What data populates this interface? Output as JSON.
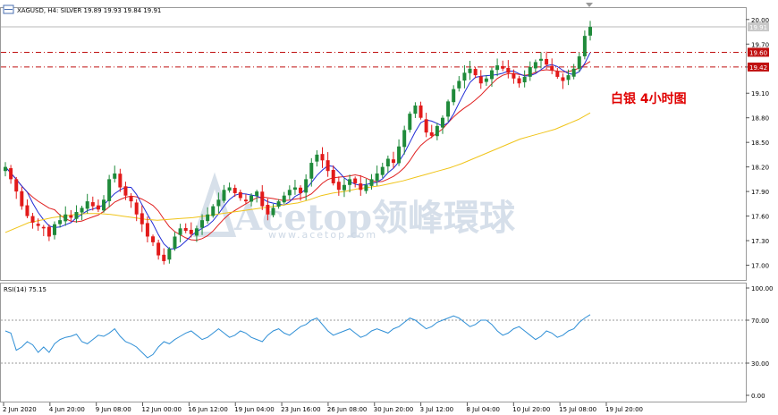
{
  "header": {
    "symbol_line": "XAGUSD, H4:  SILVER  19.89 19.93 19.84 19.91"
  },
  "annotation": "白银 4小时图",
  "watermark": {
    "brand": "Acetop领峰環球",
    "url": "www.acetop.com"
  },
  "price_axis": {
    "ticks": [
      "20.00",
      "19.70",
      "19.42",
      "19.10",
      "18.80",
      "18.50",
      "18.20",
      "17.90",
      "17.60",
      "17.30",
      "17.00"
    ],
    "tick_values": [
      20.0,
      19.7,
      19.42,
      19.1,
      18.8,
      18.5,
      18.2,
      17.9,
      17.6,
      17.3,
      17.0
    ],
    "ylim": [
      16.82,
      20.14
    ]
  },
  "rsi_axis": {
    "label": "RSI(14) 75.15",
    "ticks": [
      "100.00",
      "70.00",
      "30.00",
      "0.00"
    ],
    "tick_values": [
      100,
      70,
      30,
      0
    ],
    "levels": [
      70,
      30
    ]
  },
  "current_price": "19.91",
  "levels": [
    {
      "value": 19.6,
      "label": "19.60"
    },
    {
      "value": 19.42,
      "label": "19.42"
    }
  ],
  "colors": {
    "bull": "#1f8a3a",
    "bear": "#e21a1a",
    "ma_fast": "#1f2bd6",
    "ma_mid": "#e02020",
    "ma_slow": "#f0c419",
    "rsi": "#2f8fd6",
    "level_line": "#c01010",
    "grid": "#d8d8d8"
  },
  "time_axis": [
    "2 Jun 2020",
    "4 Jun 20:00",
    "9 Jun 08:00",
    "12 Jun 00:00",
    "16 Jun 12:00",
    "19 Jun 04:00",
    "23 Jun 16:00",
    "26 Jun 08:00",
    "30 Jun 20:00",
    "3 Jul 12:00",
    "8 Jul 04:00",
    "10 Jul 20:00",
    "15 Jul 08:00",
    "19 Jul 20:00"
  ],
  "chart_data": {
    "type": "candlestick",
    "title": "XAGUSD, H4: SILVER",
    "ylim": [
      16.82,
      20.14
    ],
    "x_labels": [
      "2 Jun 2020",
      "4 Jun 20:00",
      "9 Jun 08:00",
      "12 Jun 00:00",
      "16 Jun 12:00",
      "19 Jun 04:00",
      "23 Jun 16:00",
      "26 Jun 08:00",
      "30 Jun 20:00",
      "3 Jul 12:00",
      "8 Jul 04:00",
      "10 Jul 20:00",
      "15 Jul 08:00",
      "19 Jul 20:00"
    ],
    "close_path": [
      18.2,
      18.05,
      17.9,
      17.72,
      17.6,
      17.52,
      17.48,
      17.45,
      17.35,
      17.5,
      17.55,
      17.62,
      17.58,
      17.65,
      17.7,
      17.78,
      17.72,
      17.68,
      17.8,
      18.05,
      18.12,
      17.95,
      17.85,
      17.78,
      17.62,
      17.5,
      17.35,
      17.28,
      17.12,
      17.05,
      17.2,
      17.35,
      17.45,
      17.42,
      17.38,
      17.45,
      17.55,
      17.62,
      17.72,
      17.8,
      17.92,
      17.95,
      17.88,
      17.82,
      17.78,
      17.85,
      17.9,
      17.72,
      17.62,
      17.7,
      17.78,
      17.85,
      17.92,
      17.95,
      17.88,
      18.05,
      18.25,
      18.35,
      18.28,
      18.15,
      18.0,
      17.92,
      17.98,
      18.05,
      18.0,
      17.92,
      17.98,
      18.05,
      18.12,
      18.2,
      18.3,
      18.25,
      18.45,
      18.65,
      18.85,
      18.95,
      18.8,
      18.62,
      18.58,
      18.7,
      18.8,
      19.0,
      19.15,
      19.25,
      19.35,
      19.4,
      19.32,
      19.22,
      19.28,
      19.38,
      19.44,
      19.4,
      19.35,
      19.28,
      19.22,
      19.3,
      19.42,
      19.48,
      19.52,
      19.45,
      19.38,
      19.3,
      19.25,
      19.32,
      19.4,
      19.55,
      19.8,
      19.91
    ],
    "ma_slow": [
      17.4,
      17.46,
      17.52,
      17.55,
      17.58,
      17.6,
      17.62,
      17.63,
      17.63,
      17.62,
      17.6,
      17.58,
      17.56,
      17.55,
      17.56,
      17.57,
      17.58,
      17.6,
      17.62,
      17.64,
      17.66,
      17.68,
      17.7,
      17.72,
      17.74,
      17.76,
      17.8,
      17.85,
      17.88,
      17.9,
      17.93,
      17.95,
      17.97,
      18.0,
      18.03,
      18.07,
      18.11,
      18.15,
      18.19,
      18.24,
      18.3,
      18.36,
      18.42,
      18.48,
      18.54,
      18.58,
      18.62,
      18.66,
      18.72,
      18.78,
      18.86
    ],
    "rsi": [
      60,
      58,
      42,
      45,
      50,
      47,
      40,
      45,
      40,
      48,
      52,
      54,
      55,
      57,
      50,
      48,
      52,
      56,
      55,
      58,
      62,
      55,
      50,
      48,
      45,
      40,
      35,
      38,
      45,
      50,
      48,
      52,
      55,
      58,
      60,
      56,
      52,
      54,
      58,
      62,
      58,
      54,
      56,
      60,
      58,
      54,
      52,
      50,
      56,
      60,
      62,
      58,
      56,
      60,
      64,
      66,
      70,
      72,
      66,
      60,
      56,
      58,
      60,
      62,
      58,
      54,
      56,
      60,
      62,
      60,
      58,
      62,
      64,
      68,
      72,
      70,
      66,
      62,
      64,
      68,
      70,
      72,
      74,
      72,
      68,
      64,
      66,
      70,
      70,
      66,
      60,
      56,
      58,
      62,
      64,
      60,
      56,
      52,
      55,
      60,
      58,
      54,
      56,
      60,
      62,
      68,
      72,
      75.15
    ]
  }
}
